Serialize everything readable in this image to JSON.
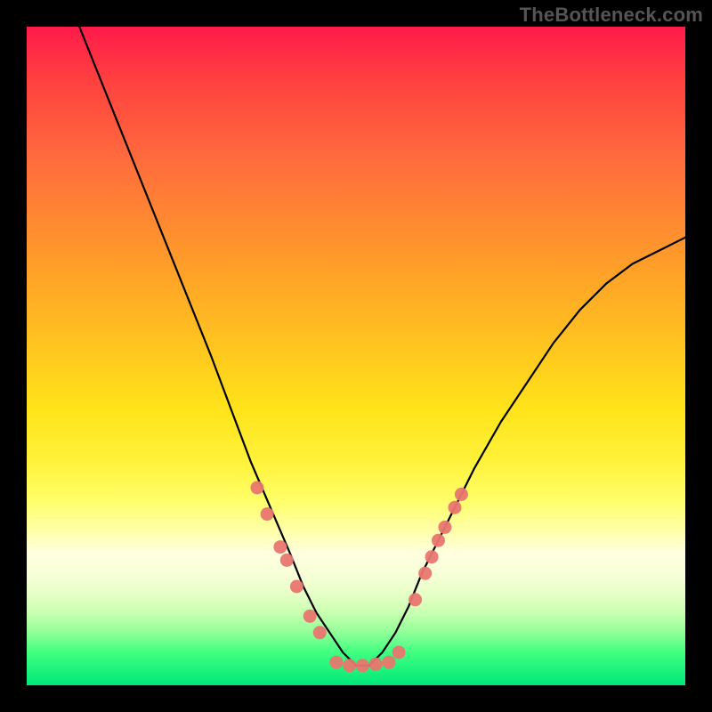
{
  "watermark": "TheBottleneck.com",
  "chart_data": {
    "type": "line",
    "title": "",
    "xlabel": "",
    "ylabel": "",
    "xlim": [
      0,
      100
    ],
    "ylim": [
      0,
      100
    ],
    "series": [
      {
        "name": "curve",
        "x": [
          8,
          12,
          16,
          20,
          24,
          28,
          31,
          34,
          37,
          40,
          42,
          44,
          46,
          48,
          50,
          52,
          54,
          56,
          58,
          60,
          64,
          68,
          72,
          76,
          80,
          84,
          88,
          92,
          96,
          100
        ],
        "y": [
          100,
          90,
          80,
          70,
          60,
          50,
          42,
          34,
          27,
          20,
          15,
          11,
          8,
          5,
          3,
          3,
          5,
          8,
          12,
          17,
          25,
          33,
          40,
          46,
          52,
          57,
          61,
          64,
          66,
          68
        ]
      }
    ],
    "markers": [
      {
        "x": 35.0,
        "y": 30.0
      },
      {
        "x": 36.5,
        "y": 26.0
      },
      {
        "x": 38.5,
        "y": 21.0
      },
      {
        "x": 39.5,
        "y": 19.0
      },
      {
        "x": 41.0,
        "y": 15.0
      },
      {
        "x": 43.0,
        "y": 10.5
      },
      {
        "x": 44.5,
        "y": 8.0
      },
      {
        "x": 47.0,
        "y": 3.5
      },
      {
        "x": 49.0,
        "y": 3.0
      },
      {
        "x": 51.0,
        "y": 3.0
      },
      {
        "x": 53.0,
        "y": 3.2
      },
      {
        "x": 55.0,
        "y": 3.5
      },
      {
        "x": 56.5,
        "y": 5.0
      },
      {
        "x": 59.0,
        "y": 13.0
      },
      {
        "x": 60.5,
        "y": 17.0
      },
      {
        "x": 61.5,
        "y": 19.5
      },
      {
        "x": 62.5,
        "y": 22.0
      },
      {
        "x": 63.5,
        "y": 24.0
      },
      {
        "x": 65.0,
        "y": 27.0
      },
      {
        "x": 66.0,
        "y": 29.0
      }
    ],
    "gradient_stops": [
      {
        "pct": 0,
        "color": "#ff1a4a"
      },
      {
        "pct": 50,
        "color": "#ffd820"
      },
      {
        "pct": 80,
        "color": "#ffffd0"
      },
      {
        "pct": 100,
        "color": "#00e878"
      }
    ]
  }
}
